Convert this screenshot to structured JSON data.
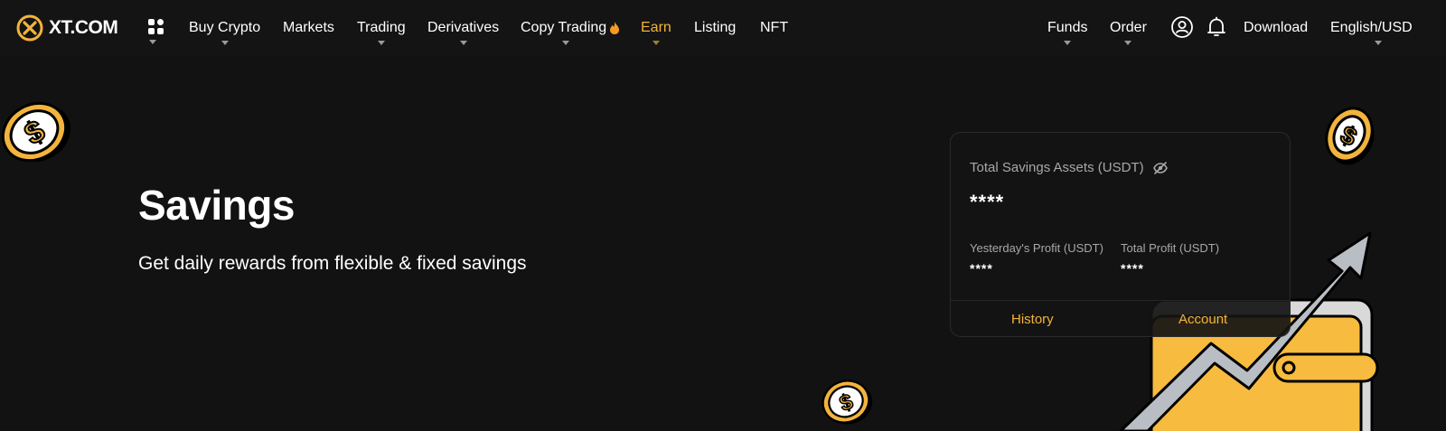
{
  "brand": {
    "logo_text": "XT.COM",
    "accent": "#F2B43C",
    "background": "#121212"
  },
  "nav": {
    "left_items": [
      {
        "label": "Buy Crypto",
        "has_caret": true
      },
      {
        "label": "Markets",
        "has_caret": false
      },
      {
        "label": "Trading",
        "has_caret": true
      },
      {
        "label": "Derivatives",
        "has_caret": true
      },
      {
        "label": "Copy Trading",
        "has_caret": true,
        "icon": "flame-icon"
      },
      {
        "label": "Earn",
        "has_caret": true,
        "active": true
      },
      {
        "label": "Listing",
        "has_caret": false
      },
      {
        "label": "NFT",
        "has_caret": false
      }
    ],
    "right_items": {
      "funds": "Funds",
      "order": "Order",
      "download": "Download",
      "language": "English/USD"
    },
    "icons": [
      "apps-grid-icon",
      "user-icon",
      "bell-icon"
    ]
  },
  "hero": {
    "title": "Savings",
    "subtitle": "Get daily rewards from flexible & fixed savings"
  },
  "assets_card": {
    "total_label": "Total Savings Assets (USDT)",
    "total_value": "****",
    "yesterday_label": "Yesterday's Profit (USDT)",
    "yesterday_value": "****",
    "total_profit_label": "Total Profit (USDT)",
    "total_profit_value": "****",
    "history_link": "History",
    "account_link": "Account",
    "visibility_icon": "eye-slash-icon"
  },
  "decorations": [
    "dollar-coin-icon",
    "wallet-icon",
    "growth-arrow-icon"
  ]
}
